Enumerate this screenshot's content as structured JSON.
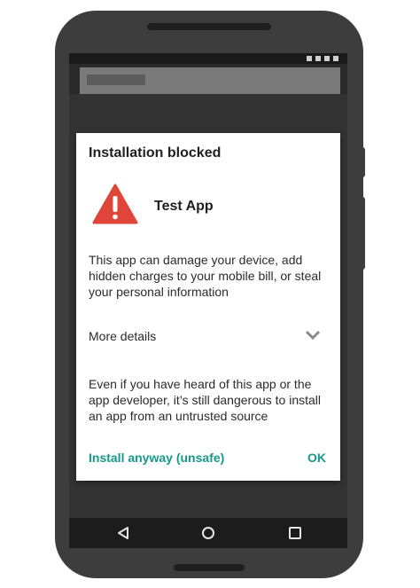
{
  "dialog": {
    "title": "Installation blocked",
    "app_name": "Test App",
    "warning_message": "This app can damage your device, add hidden charges to your mobile bill, or steal your personal information",
    "more_details_label": "More details",
    "explanation": "Even if you have heard of this app or the app developer, it’s still dangerous to install an app from an untrusted source",
    "install_anyway_label": "Install anyway (unsafe)",
    "ok_label": "OK"
  },
  "icons": {
    "warning": "warning-triangle-icon",
    "chevron": "chevron-down-icon",
    "back": "back-triangle-icon",
    "home": "home-circle-icon",
    "recent": "recent-apps-square-icon"
  },
  "colors": {
    "accent": "#14998a",
    "warning": "#e0453a",
    "phone_body": "#3d3d3d",
    "dialog_bg": "#ffffff"
  }
}
